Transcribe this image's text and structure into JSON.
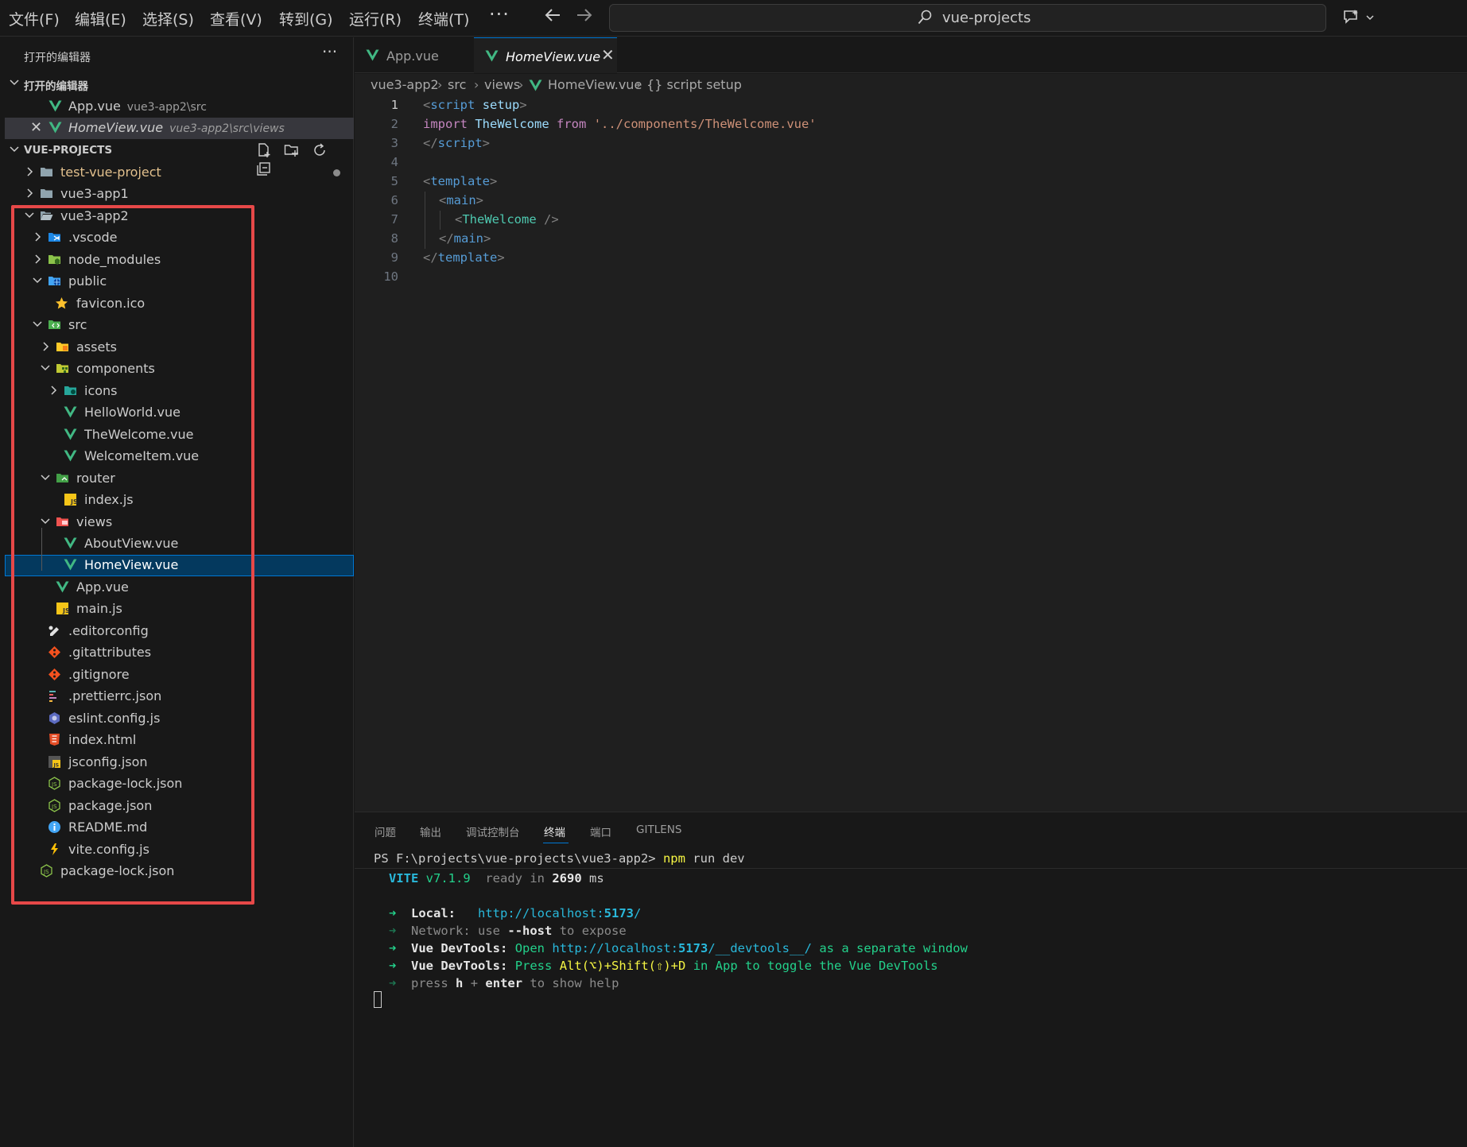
{
  "menubar": {
    "items": [
      "文件(F)",
      "编辑(E)",
      "选择(S)",
      "查看(V)",
      "转到(G)",
      "运行(R)",
      "终端(T)"
    ],
    "more": "···"
  },
  "search": {
    "text": "vue-projects"
  },
  "sidebar": {
    "title": "打开的编辑器",
    "more": "···",
    "open_editors": {
      "header": "打开的编辑器",
      "items": [
        {
          "name": "App.vue",
          "path": "vue3-app2\\src"
        },
        {
          "name": "HomeView.vue",
          "path": "vue3-app2\\src\\views"
        }
      ]
    },
    "workspace": {
      "header": "VUE-PROJECTS",
      "items": [
        {
          "label": "test-vue-project"
        },
        {
          "label": "vue3-app1"
        },
        {
          "label": "vue3-app2"
        },
        {
          "label": ".vscode"
        },
        {
          "label": "node_modules"
        },
        {
          "label": "public"
        },
        {
          "label": "favicon.ico"
        },
        {
          "label": "src"
        },
        {
          "label": "assets"
        },
        {
          "label": "components"
        },
        {
          "label": "icons"
        },
        {
          "label": "HelloWorld.vue"
        },
        {
          "label": "TheWelcome.vue"
        },
        {
          "label": "WelcomeItem.vue"
        },
        {
          "label": "router"
        },
        {
          "label": "index.js"
        },
        {
          "label": "views"
        },
        {
          "label": "AboutView.vue"
        },
        {
          "label": "HomeView.vue"
        },
        {
          "label": "App.vue"
        },
        {
          "label": "main.js"
        },
        {
          "label": ".editorconfig"
        },
        {
          "label": ".gitattributes"
        },
        {
          "label": ".gitignore"
        },
        {
          "label": ".prettierrc.json"
        },
        {
          "label": "eslint.config.js"
        },
        {
          "label": "index.html"
        },
        {
          "label": "jsconfig.json"
        },
        {
          "label": "package-lock.json"
        },
        {
          "label": "package.json"
        },
        {
          "label": "README.md"
        },
        {
          "label": "vite.config.js"
        },
        {
          "label": "package-lock.json"
        }
      ]
    }
  },
  "tabs": [
    {
      "label": "App.vue"
    },
    {
      "label": "HomeView.vue",
      "close": "✕"
    }
  ],
  "breadcrumb": [
    "vue3-app2",
    "src",
    "views",
    "HomeView.vue",
    "{} script setup"
  ],
  "editor": {
    "line_numbers": [
      "1",
      "2",
      "3",
      "4",
      "5",
      "6",
      "7",
      "8",
      "9",
      "10"
    ],
    "lines": [
      [
        "<",
        "script",
        " ",
        "setup",
        ">"
      ],
      [
        "import",
        " ",
        "TheWelcome",
        " ",
        "from",
        " ",
        "'../components/TheWelcome.vue'"
      ],
      [
        "</",
        "script",
        ">"
      ],
      [],
      [
        "<",
        "template",
        ">"
      ],
      [
        "<",
        "main",
        ">"
      ],
      [
        "<",
        "TheWelcome",
        " />"
      ],
      [
        "</",
        "main",
        ">"
      ],
      [
        "</",
        "template",
        ">"
      ],
      []
    ]
  },
  "panel": {
    "tabs": [
      "问题",
      "输出",
      "调试控制台",
      "终端",
      "端口",
      "GITLENS"
    ],
    "terminal": {
      "prompt": "PS F:\\projects\\vue-projects\\vue3-app2>",
      "command_npm": "npm",
      "command_rest": " run dev",
      "vite": "VITE",
      "version": "v7.1.9",
      "ready": "ready in",
      "ready_ms": "2690",
      "ms": "ms",
      "arrow": "➜",
      "local_label": "Local:",
      "local_url_a": "http://localhost:",
      "local_url_port": "5173",
      "local_url_b": "/",
      "network_label": "Network:",
      "network_use": "use",
      "network_host": "--host",
      "network_rest": "to expose",
      "devtools_label": "Vue DevTools:",
      "devtools_open": "Open",
      "devtools_url_a": "http://localhost:",
      "devtools_url_port": "5173",
      "devtools_url_b": "/__devtools__/",
      "devtools_open_rest": "as a separate window",
      "devtools_press": "Press",
      "devtools_keys": "Alt(⌥)+Shift(⇧)+D",
      "devtools_press_rest": "in App to toggle the Vue DevTools",
      "help_press": "press",
      "help_h": "h",
      "help_plus": "+",
      "help_enter": "enter",
      "help_rest": "to show help"
    }
  },
  "colors": {
    "vue_green": "#41b883",
    "highlight_box": "#e64848",
    "selection": "#04395e",
    "accent": "#0078d4"
  }
}
